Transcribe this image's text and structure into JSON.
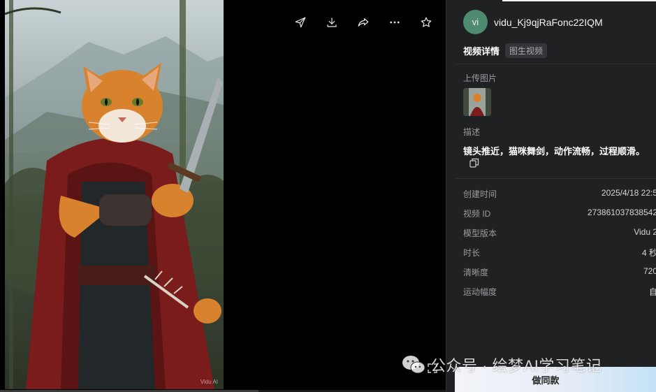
{
  "viewer": {
    "video_watermark": "Vidu AI",
    "toolbar": [
      {
        "name": "send-icon",
        "interactable": true
      },
      {
        "name": "download-icon",
        "interactable": true
      },
      {
        "name": "share-icon",
        "interactable": true
      },
      {
        "name": "more-icon",
        "interactable": true
      },
      {
        "name": "star-icon",
        "interactable": true
      }
    ],
    "playback_progress": 0.58
  },
  "panel": {
    "avatar_initials": "vi",
    "username": "vidu_Kj9qjRaFonc22IQM",
    "tab_active": "视频详情",
    "tab_badge": "图生视频",
    "upload_label": "上传图片",
    "desc_label": "描述",
    "description": "镜头推近，猫咪舞剑，动作流畅，过程顺滑。",
    "meta": [
      {
        "key": "创建时间",
        "value": "2025/4/18 22:5"
      },
      {
        "key": "视频 ID",
        "value": "273861037838542"
      },
      {
        "key": "模型版本",
        "value": "Vidu 2"
      },
      {
        "key": "时长",
        "value": "4 秒"
      },
      {
        "key": "清晰度",
        "value": "720"
      },
      {
        "key": "运动幅度",
        "value": "自"
      }
    ],
    "cta_label": "做同款"
  },
  "overlay": {
    "wechat_watermark": "公众号 · 绘梦AI学习笔记"
  },
  "colors": {
    "panel_bg": "#202123",
    "avatar_bg": "#4f8a72",
    "cape_red": "#7a1c1c",
    "cat_orange": "#d9822e"
  }
}
